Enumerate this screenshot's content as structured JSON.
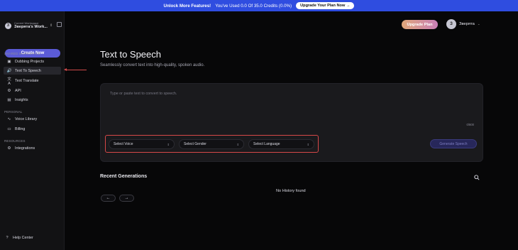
{
  "banner": {
    "lead": "Unlock More Features!",
    "usage": "You've Used 0.0 Of 35.0 Credits (0.0%)",
    "cta": "Upgrade Your Plan Now →"
  },
  "sidebar": {
    "workspace_label": "Current Workspace",
    "workspace_name": "Зверята's Work...",
    "workspace_initial": "З",
    "create_label": "Create New",
    "shared_label": "SHARED WORKSPACE",
    "shared_items": [
      {
        "label": "Dubbing Projects",
        "icon": "▣"
      },
      {
        "label": "Text To Speech",
        "icon": "🔊"
      },
      {
        "label": "Text Translate",
        "icon": "文A"
      },
      {
        "label": "API",
        "icon": "⚙"
      },
      {
        "label": "Insights",
        "icon": "▤"
      }
    ],
    "personal_label": "PERSONAL",
    "personal_items": [
      {
        "label": "Voice Library",
        "icon": "∿"
      },
      {
        "label": "Billing",
        "icon": "▭"
      }
    ],
    "resources_label": "RESOURCES",
    "resources_items": [
      {
        "label": "Integrations",
        "icon": "⚙"
      }
    ],
    "help_label": "Help Center",
    "help_icon": "?"
  },
  "header": {
    "upgrade_label": "Upgrade Plan",
    "user_initial": "З",
    "user_name": "Зверята"
  },
  "main": {
    "title": "Text to Speech",
    "subtitle": "Seamlessly convert text into high-quality, spoken audio.",
    "editor_placeholder": "Type or paste text to convert to speech.",
    "char_count": "0/800",
    "selects": {
      "voice": "Select Voice",
      "gender": "Select Gender",
      "language": "Select Language"
    },
    "generate_label": "Generate Speech",
    "recent_title": "Recent Generations",
    "no_history": "No History found",
    "prev": "←",
    "next": "→"
  },
  "colors": {
    "accent": "#5b5bd6",
    "banner": "#2f4de0",
    "highlight": "#d64848"
  }
}
